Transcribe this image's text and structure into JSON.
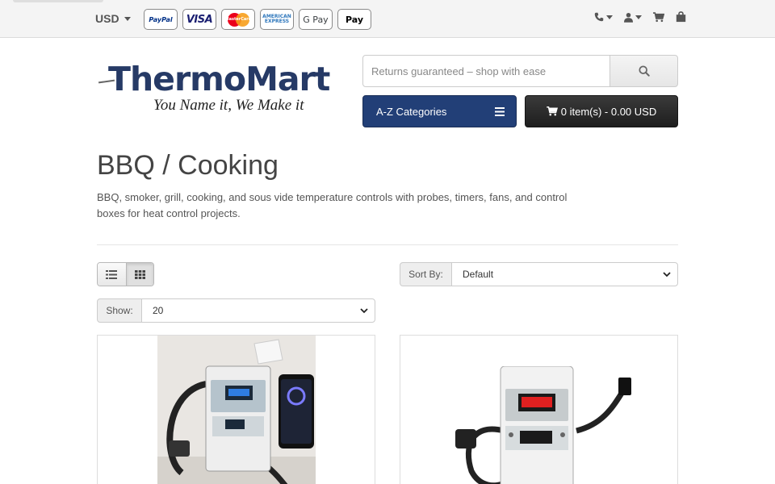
{
  "topbar": {
    "currency": "USD",
    "payment_methods": [
      {
        "name": "PayPal",
        "label": "PayPal",
        "icon": "paypal-icon"
      },
      {
        "name": "Visa",
        "label": "VISA",
        "icon": "visa-icon"
      },
      {
        "name": "MasterCard",
        "label": "MasterCard",
        "icon": "mastercard-icon"
      },
      {
        "name": "American Express",
        "label": "AMERICAN EXPRESS",
        "icon": "amex-icon"
      },
      {
        "name": "Google Pay",
        "label": "G Pay",
        "icon": "google-pay-icon"
      },
      {
        "name": "Apple Pay",
        "label": "Pay",
        "icon": "apple-pay-icon"
      }
    ],
    "icons": [
      "phone-icon",
      "user-icon",
      "cart-icon",
      "bag-icon"
    ]
  },
  "header": {
    "logo_name": "ThermoMart",
    "logo_slogan": "You Name it, We Make it",
    "search_value": "Returns guaranteed – shop with ease",
    "categories_label": "A-Z Categories",
    "cart_label": "0 item(s) - 0.00 USD"
  },
  "category": {
    "title": "BBQ / Cooking",
    "description": "BBQ, smoker, grill, cooking, and sous vide temperature controls with probes, timers, fans, and control boxes for heat control projects."
  },
  "controls": {
    "active_view": "grid",
    "sort_label": "Sort By:",
    "sort_value": "Default",
    "show_label": "Show:",
    "show_value": "20"
  },
  "colors": {
    "brand_blue": "#223f77",
    "cart_dark": "#222222",
    "logo_blue": "#263a66"
  }
}
